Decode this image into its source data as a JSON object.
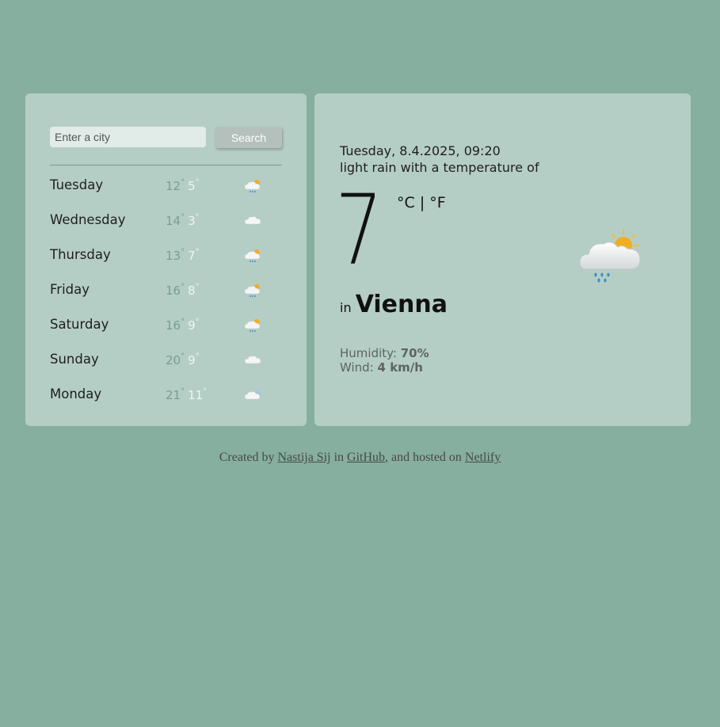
{
  "search": {
    "placeholder": "Enter a city",
    "button_label": "Search"
  },
  "forecast": [
    {
      "day": "Tuesday",
      "max": "12",
      "min": "5",
      "icon": "partly-cloudy-rain-icon"
    },
    {
      "day": "Wednesday",
      "max": "14",
      "min": "3",
      "icon": "cloud-icon"
    },
    {
      "day": "Thursday",
      "max": "13",
      "min": "7",
      "icon": "partly-cloudy-rain-icon"
    },
    {
      "day": "Friday",
      "max": "16",
      "min": "8",
      "icon": "partly-cloudy-rain-icon"
    },
    {
      "day": "Saturday",
      "max": "16",
      "min": "9",
      "icon": "partly-cloudy-rain-icon"
    },
    {
      "day": "Sunday",
      "max": "20",
      "min": "9",
      "icon": "cloud-icon"
    },
    {
      "day": "Monday",
      "max": "21",
      "min": "11",
      "icon": "partly-cloudy-icon"
    }
  ],
  "current": {
    "date": "Tuesday, 8.4.2025, 09:20",
    "description": "light rain with a temperature of",
    "temperature": "7",
    "unit_c": "°C",
    "unit_sep": " | ",
    "unit_f": "°F",
    "in_label": "in",
    "city": "Vienna",
    "humidity_label": "Humidity: ",
    "humidity": "70%",
    "wind_label": "Wind: ",
    "wind": "4 km/h",
    "icon": "partly-cloudy-rain-icon"
  },
  "footer": {
    "prefix": "Created by ",
    "author": "Nastija Sij",
    "mid": " in ",
    "github": "GitHub",
    "mid2": ", and hosted on ",
    "netlify": "Netlify"
  },
  "colors": {
    "background": "#86afa0",
    "card": "#b5cec5",
    "max_temp": "#779e90",
    "min_temp": "#eef5f2"
  }
}
